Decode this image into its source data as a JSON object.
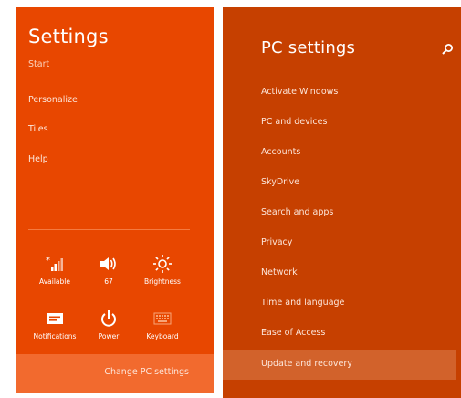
{
  "settings_charm": {
    "title": "Settings",
    "start": "Start",
    "links": [
      "Personalize",
      "Tiles",
      "Help"
    ],
    "quick_tiles": [
      {
        "label": "Available",
        "icon": "network-signal-icon"
      },
      {
        "label": "67",
        "icon": "volume-icon"
      },
      {
        "label": "Brightness",
        "icon": "brightness-icon"
      },
      {
        "label": "Notifications",
        "icon": "notifications-icon"
      },
      {
        "label": "Power",
        "icon": "power-icon"
      },
      {
        "label": "Keyboard",
        "icon": "keyboard-icon"
      }
    ],
    "change_pc_settings": "Change PC settings"
  },
  "pc_settings": {
    "title": "PC settings",
    "search_icon": "search-icon",
    "items": [
      "Activate Windows",
      "PC and devices",
      "Accounts",
      "SkyDrive",
      "Search and apps",
      "Privacy",
      "Network",
      "Time and language",
      "Ease of Access",
      "Update and recovery"
    ],
    "selected_item": "Update and recovery"
  },
  "colors": {
    "charm_background": "#e84700",
    "charm_highlight": "#f26a2e",
    "pc_settings_background": "#c64000",
    "pc_settings_selected": "#d2622b",
    "text": "#ffffff"
  }
}
